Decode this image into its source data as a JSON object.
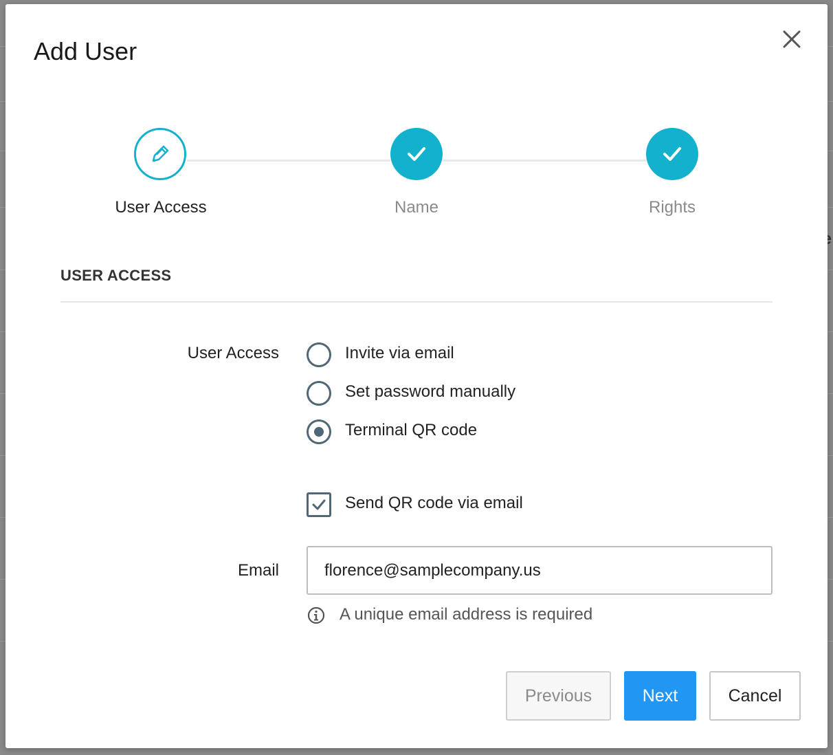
{
  "dialog": {
    "title": "Add User"
  },
  "stepper": {
    "steps": [
      {
        "label": "User Access",
        "state": "active",
        "icon": "pencil-icon"
      },
      {
        "label": "Name",
        "state": "done",
        "icon": "check-icon"
      },
      {
        "label": "Rights",
        "state": "done",
        "icon": "check-icon"
      }
    ],
    "accent_color": "#13b1cd"
  },
  "section": {
    "title": "USER ACCESS"
  },
  "form": {
    "user_access_label": "User Access",
    "options": [
      {
        "label": "Invite via email",
        "selected": false
      },
      {
        "label": "Set password manually",
        "selected": false
      },
      {
        "label": "Terminal QR code",
        "selected": true
      }
    ],
    "send_qr_label": "Send QR code via email",
    "send_qr_checked": true,
    "email_label": "Email",
    "email_value": "florence@samplecompany.us",
    "email_hint": "A unique email address is required"
  },
  "buttons": {
    "previous": "Previous",
    "next": "Next",
    "cancel": "Cancel",
    "primary_color": "#2196f3"
  },
  "background": {
    "partial_glyph": "e"
  }
}
